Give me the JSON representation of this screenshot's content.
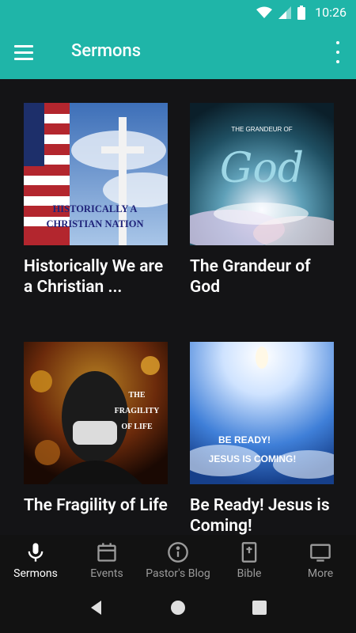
{
  "status_bar": {
    "time": "10:26"
  },
  "app_bar": {
    "title": "Sermons"
  },
  "sermons": [
    {
      "title": "Historically We are a Christian ...",
      "thumb_text": "HISTORICALLY A CHRISTIAN NATION"
    },
    {
      "title": "The Grandeur of God",
      "thumb_text_top": "THE GRANDEUR OF",
      "thumb_text_main": "God"
    },
    {
      "title": "The Fragility of Life",
      "thumb_text": "THE FRAGILITY OF LIFE"
    },
    {
      "title": "Be Ready! Jesus is Coming!",
      "thumb_text_1": "BE READY!",
      "thumb_text_2": "JESUS IS COMING!"
    }
  ],
  "bottom_nav": [
    {
      "label": "Sermons",
      "icon": "microphone-icon",
      "active": true
    },
    {
      "label": "Events",
      "icon": "calendar-icon",
      "active": false
    },
    {
      "label": "Pastor's Blog",
      "icon": "info-icon",
      "active": false
    },
    {
      "label": "Bible",
      "icon": "bible-icon",
      "active": false
    },
    {
      "label": "More",
      "icon": "tv-icon",
      "active": false
    }
  ],
  "colors": {
    "primary": "#1fb5a8",
    "background": "#121212"
  }
}
